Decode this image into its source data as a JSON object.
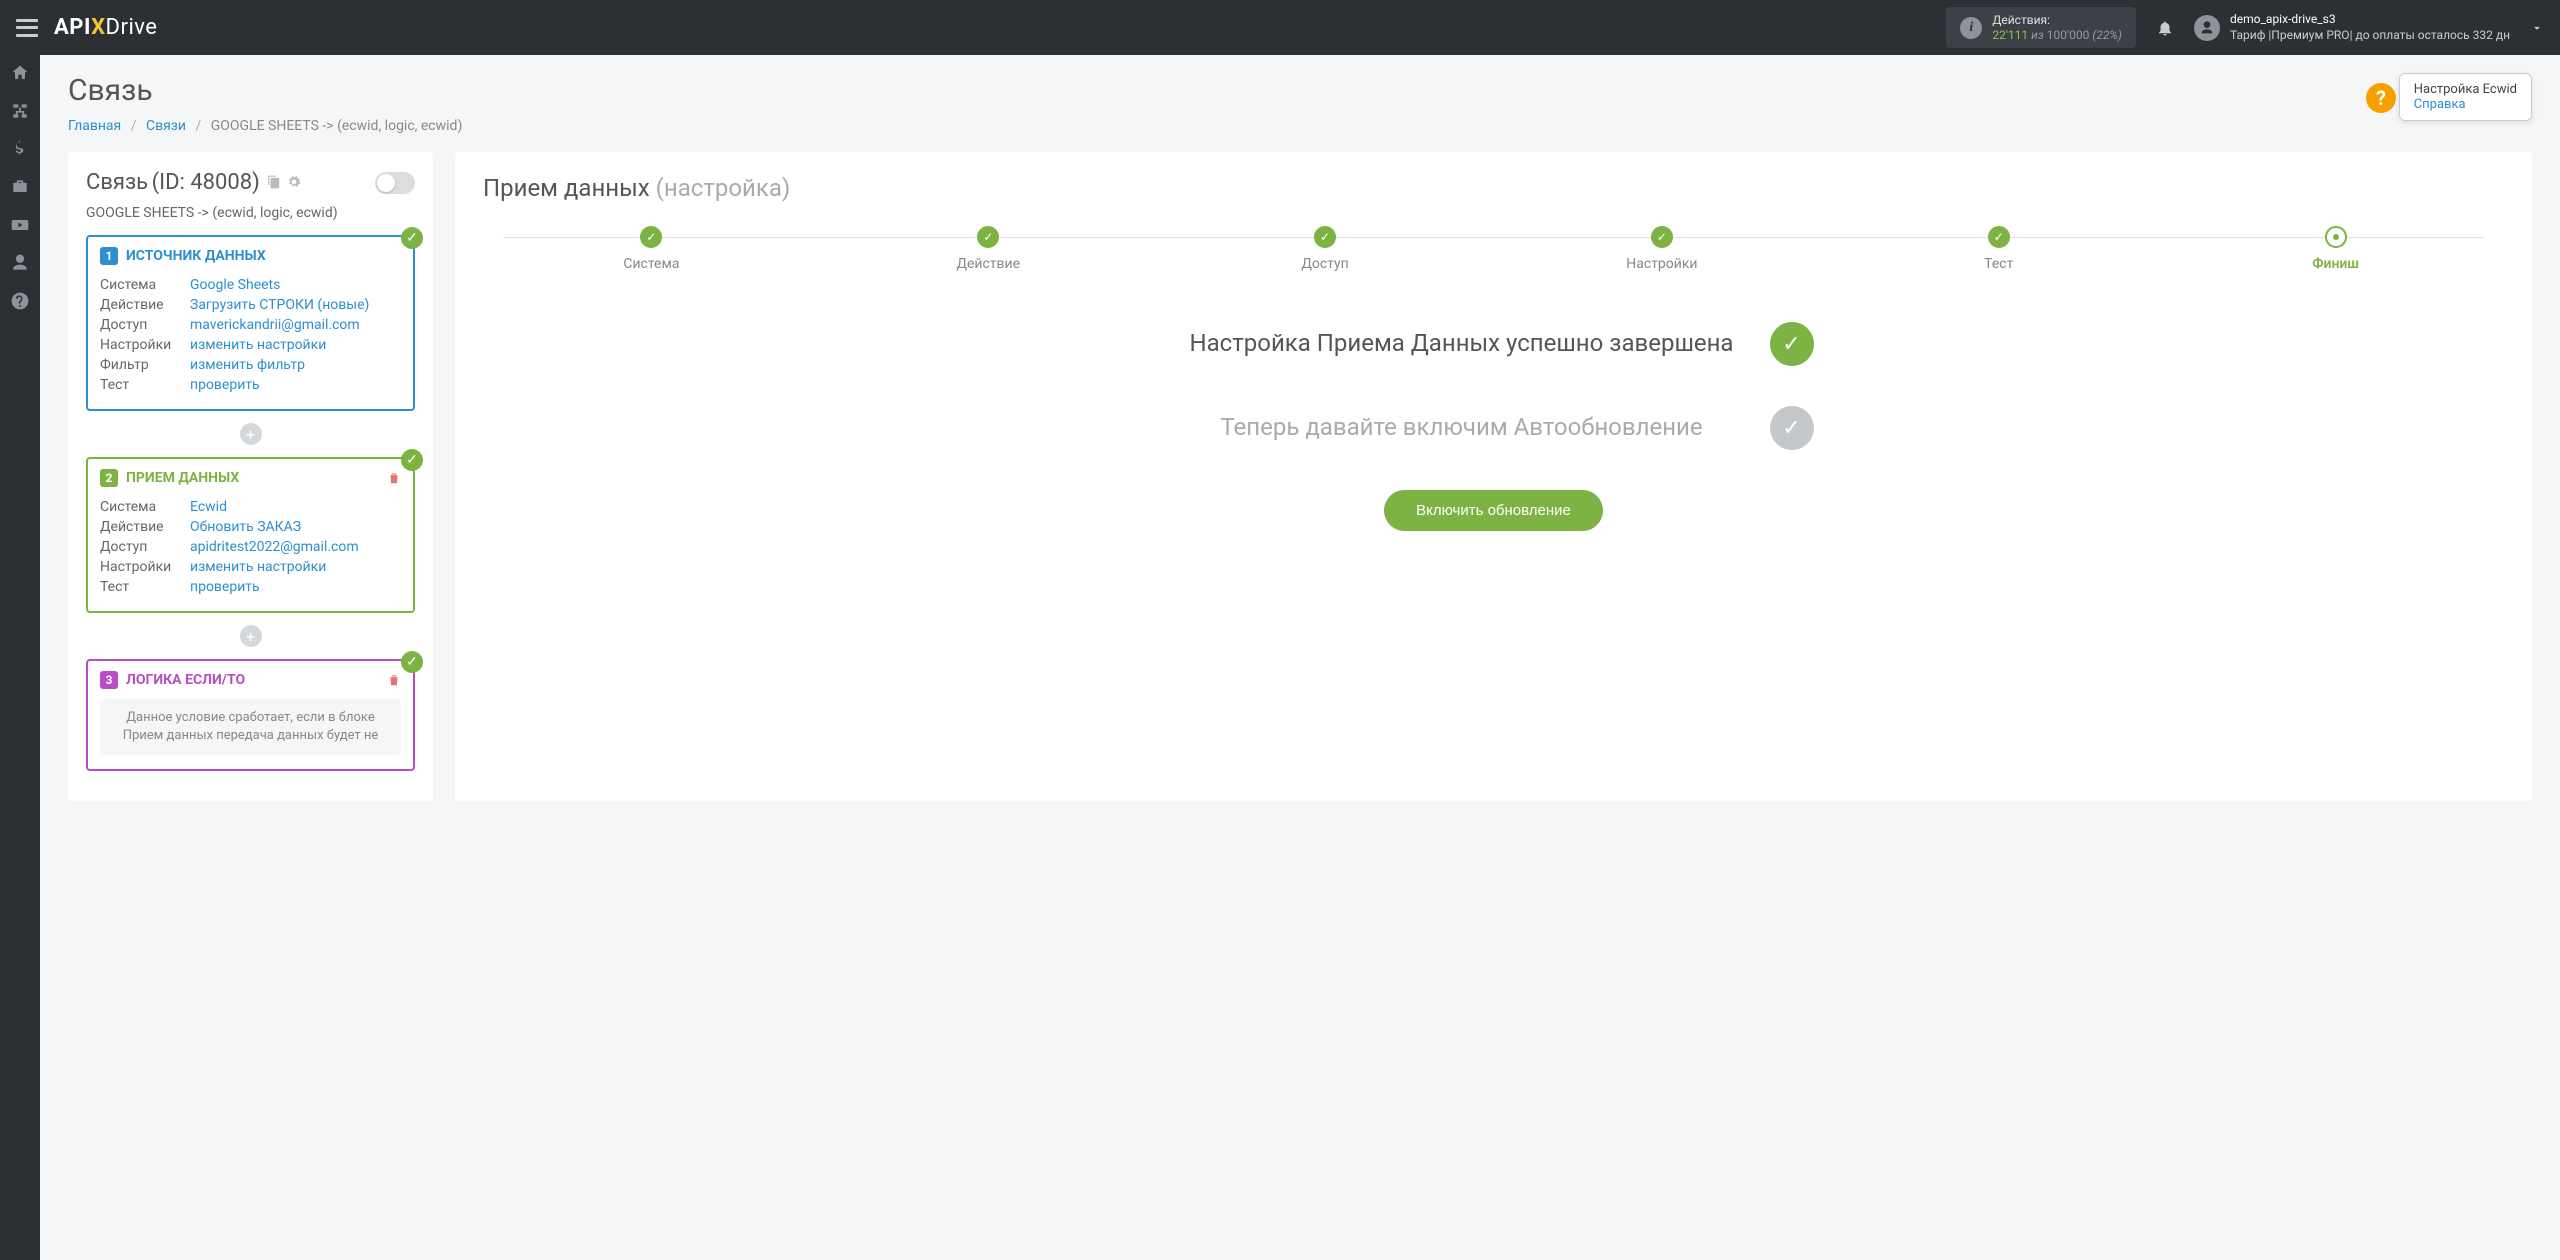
{
  "topbar": {
    "actions_label": "Действия:",
    "actions_used": "22'111",
    "actions_of": "из",
    "actions_total": "100'000",
    "actions_pct": "(22%)",
    "user_name": "demo_apix-drive_s3",
    "tariff_line": "Тариф |Премиум PRO| до оплаты осталось 332 дн"
  },
  "page": {
    "title": "Связь",
    "breadcrumb": {
      "home": "Главная",
      "links": "Связи",
      "current": "GOOGLE SHEETS -> (ecwid, logic, ecwid)"
    }
  },
  "help": {
    "title": "Настройка Ecwid",
    "link": "Справка"
  },
  "left_panel": {
    "title": "Связь",
    "id": "(ID: 48008)",
    "subtitle": "GOOGLE SHEETS -> (ecwid, logic, ecwid)",
    "cards": [
      {
        "num": "1",
        "title": "ИСТОЧНИК ДАННЫХ",
        "rows": [
          {
            "k": "Система",
            "v": "Google Sheets"
          },
          {
            "k": "Действие",
            "v": "Загрузить СТРОКИ (новые)"
          },
          {
            "k": "Доступ",
            "v": "maverickandrii@gmail.com"
          },
          {
            "k": "Настройки",
            "v": "изменить настройки"
          },
          {
            "k": "Фильтр",
            "v": "изменить фильтр"
          },
          {
            "k": "Тест",
            "v": "проверить"
          }
        ]
      },
      {
        "num": "2",
        "title": "ПРИЕМ ДАННЫХ",
        "rows": [
          {
            "k": "Система",
            "v": "Ecwid"
          },
          {
            "k": "Действие",
            "v": "Обновить ЗАКАЗ"
          },
          {
            "k": "Доступ",
            "v": "apidritest2022@gmail.com"
          },
          {
            "k": "Настройки",
            "v": "изменить настройки"
          },
          {
            "k": "Тест",
            "v": "проверить"
          }
        ]
      },
      {
        "num": "3",
        "title": "ЛОГИКА ЕСЛИ/ТО",
        "note": "Данное условие сработает, если в блоке Прием данных передача данных будет не"
      }
    ]
  },
  "right_panel": {
    "title": "Прием данных",
    "subtitle": "(настройка)",
    "steps": [
      {
        "label": "Система",
        "state": "done"
      },
      {
        "label": "Действие",
        "state": "done"
      },
      {
        "label": "Доступ",
        "state": "done"
      },
      {
        "label": "Настройки",
        "state": "done"
      },
      {
        "label": "Тест",
        "state": "done"
      },
      {
        "label": "Финиш",
        "state": "active"
      }
    ],
    "finish": {
      "line1": "Настройка Приема Данных успешно завершена",
      "line2": "Теперь давайте включим Автообновление",
      "button": "Включить обновление"
    }
  }
}
